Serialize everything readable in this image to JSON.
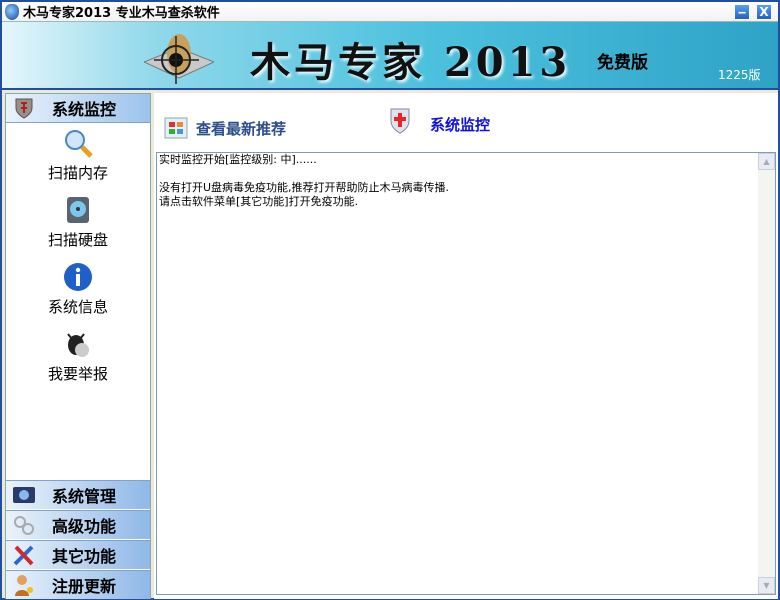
{
  "window": {
    "title": "木马专家2013  专业木马查杀软件",
    "minimize": "‒",
    "close": "X"
  },
  "banner": {
    "title": "木马专家 2013",
    "edition": "免费版",
    "version": "1225版"
  },
  "sidebar": {
    "header": "系统监控",
    "items": [
      {
        "label": "扫描内存",
        "icon": "magnifier-icon"
      },
      {
        "label": "扫描硬盘",
        "icon": "harddisk-icon"
      },
      {
        "label": "系统信息",
        "icon": "info-icon"
      },
      {
        "label": "我要举报",
        "icon": "bug-icon"
      }
    ],
    "bottom": [
      {
        "label": "系统管理",
        "icon": "system-manage-icon"
      },
      {
        "label": "高级功能",
        "icon": "gears-icon"
      },
      {
        "label": "其它功能",
        "icon": "tools-icon"
      },
      {
        "label": "注册更新",
        "icon": "user-key-icon"
      }
    ]
  },
  "main": {
    "recommend_label": "查看最新推荐",
    "monitor_label": "系统监控",
    "log_lines": [
      "实时监控开始[监控级别: 中]......",
      "",
      "没有打开U盘病毒免疫功能,推荐打开帮助防止木马病毒传播.",
      "请点击软件菜单[其它功能]打开免疫功能."
    ]
  }
}
